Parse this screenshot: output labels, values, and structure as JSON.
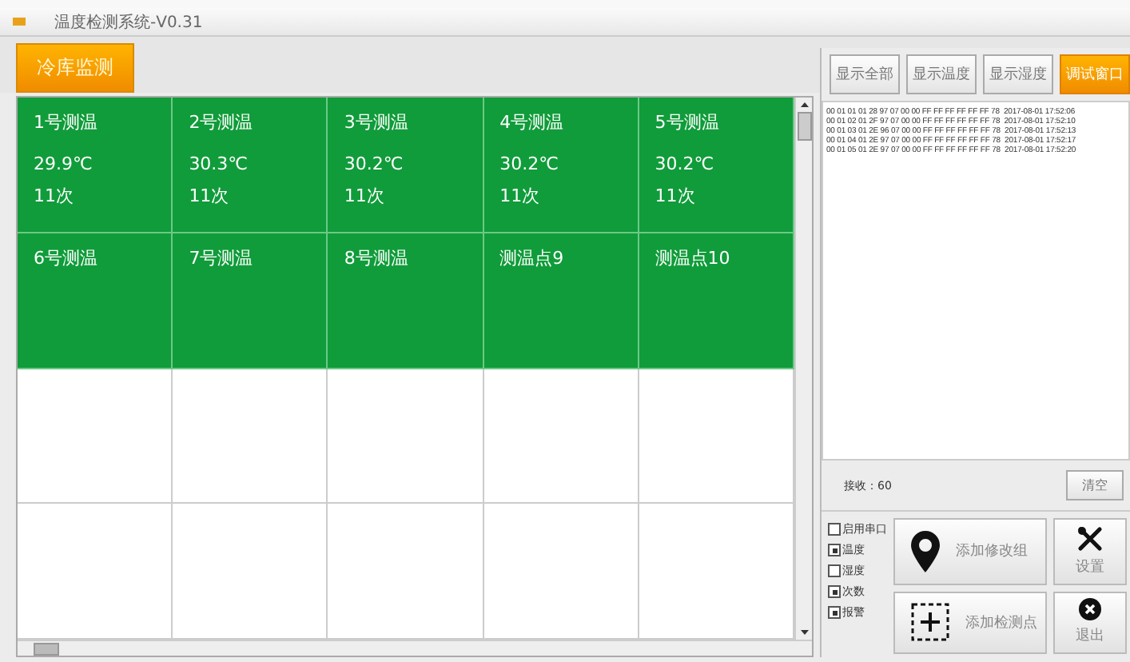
{
  "window": {
    "title": "温度检测系统-V0.31"
  },
  "tabs": [
    {
      "label": "冷库监测",
      "selected": true
    }
  ],
  "sensors": [
    {
      "name": "1号测温",
      "temperature": "29.9℃",
      "count": "11次",
      "online": true
    },
    {
      "name": "2号测温",
      "temperature": "30.3℃",
      "count": "11次",
      "online": true
    },
    {
      "name": "3号测温",
      "temperature": "30.2℃",
      "count": "11次",
      "online": true
    },
    {
      "name": "4号测温",
      "temperature": "30.2℃",
      "count": "11次",
      "online": true
    },
    {
      "name": "5号测温",
      "temperature": "30.2℃",
      "count": "11次",
      "online": true
    },
    {
      "name": "6号测温",
      "online": true
    },
    {
      "name": "7号测温",
      "online": true
    },
    {
      "name": "8号测温",
      "online": true
    },
    {
      "name": "测温点9",
      "online": true
    },
    {
      "name": "测温点10",
      "online": true
    }
  ],
  "view_buttons": [
    {
      "label": "显示全部",
      "selected": false
    },
    {
      "label": "显示温度",
      "selected": false
    },
    {
      "label": "显示湿度",
      "selected": false
    },
    {
      "label": "调试窗口",
      "selected": true
    }
  ],
  "log": [
    {
      "data": "00 01 01 01 28 97 07 00 00 FF FF FF FF FF FF 78",
      "time": "2017-08-01 17:52:06"
    },
    {
      "data": "00 01 02 01 2F 97 07 00 00 FF FF FF FF FF FF 78",
      "time": "2017-08-01 17:52:10"
    },
    {
      "data": "00 01 03 01 2E 96 07 00 00 FF FF FF FF FF FF 78",
      "time": "2017-08-01 17:52:13"
    },
    {
      "data": "00 01 04 01 2E 97 07 00 00 FF FF FF FF FF FF 78",
      "time": "2017-08-01 17:52:17"
    },
    {
      "data": "00 01 05 01 2E 97 07 00 00 FF FF FF FF FF FF 78",
      "time": "2017-08-01 17:52:20"
    }
  ],
  "receive_label": "接收：60",
  "clear_button": "清空",
  "options": [
    {
      "label": "启用串口",
      "checked": false
    },
    {
      "label": "温度",
      "checked": true
    },
    {
      "label": "湿度",
      "checked": false
    },
    {
      "label": "次数",
      "checked": true
    },
    {
      "label": "报警",
      "checked": true
    }
  ],
  "actions": [
    {
      "kind": "group",
      "label": "添加修改组"
    },
    {
      "kind": "settings",
      "label": "设置"
    },
    {
      "kind": "point",
      "label": "添加检测点"
    },
    {
      "kind": "exit",
      "label": "退出"
    }
  ]
}
